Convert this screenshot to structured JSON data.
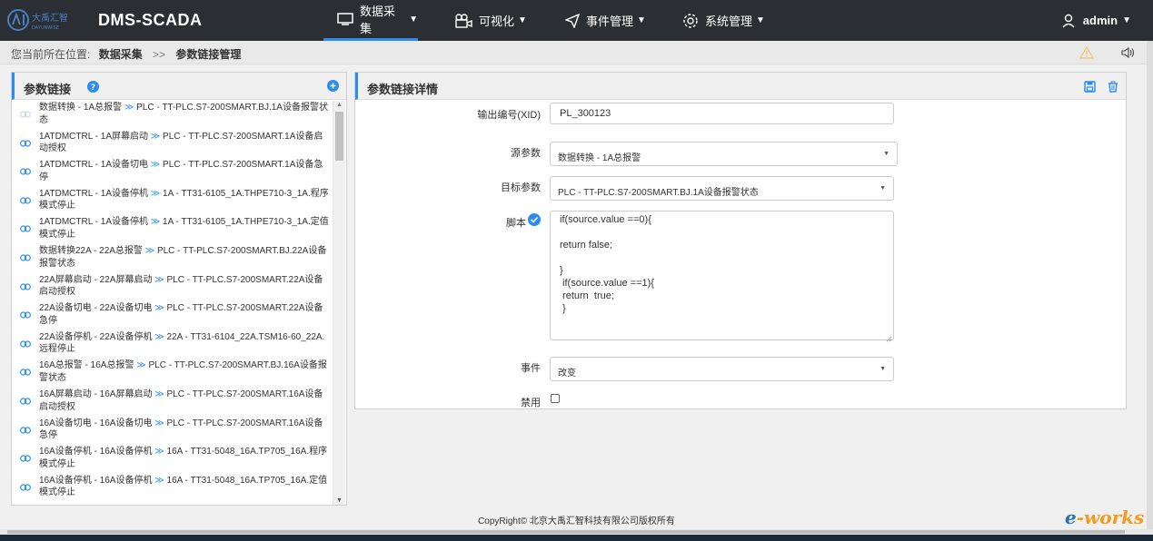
{
  "app": {
    "logo_text": "大禹汇智",
    "logo_subtext": "DAYUNWISE",
    "title": "DMS-SCADA"
  },
  "nav": [
    {
      "label": "数据采集",
      "icon": "monitor-icon",
      "active": true
    },
    {
      "label": "可视化",
      "icon": "camera-icon",
      "active": false
    },
    {
      "label": "事件管理",
      "icon": "send-icon",
      "active": false
    },
    {
      "label": "系统管理",
      "icon": "gear-icon",
      "active": false
    }
  ],
  "user": {
    "name": "admin",
    "icon": "user-icon"
  },
  "breadcrumb": {
    "prefix": "您当前所在位置:",
    "level1": "数据采集",
    "separator": ">>",
    "level2": "参数链接管理"
  },
  "left_panel": {
    "title": "参数链接",
    "items": [
      {
        "source": "数据转换 - 1A总报警",
        "target": "PLC - TT-PLC.S7-200SMART.BJ.1A设备报警状态"
      },
      {
        "source": "1ATDMCTRL - 1A屏幕启动",
        "target": "PLC - TT-PLC.S7-200SMART.1A设备启动授权"
      },
      {
        "source": "1ATDMCTRL - 1A设备切电",
        "target": "PLC - TT-PLC.S7-200SMART.1A设备急停"
      },
      {
        "source": "1ATDMCTRL - 1A设备停机",
        "target": "1A - TT31-6105_1A.THPE710-3_1A.程序模式停止"
      },
      {
        "source": "1ATDMCTRL - 1A设备停机",
        "target": "1A - TT31-6105_1A.THPE710-3_1A.定值模式停止"
      },
      {
        "source": "数据转换22A - 22A总报警",
        "target": "PLC - TT-PLC.S7-200SMART.BJ.22A设备报警状态"
      },
      {
        "source": "22A屏幕启动 - 22A屏幕启动",
        "target": "PLC - TT-PLC.S7-200SMART.22A设备启动授权"
      },
      {
        "source": "22A设备切电 - 22A设备切电",
        "target": "PLC - TT-PLC.S7-200SMART.22A设备急停"
      },
      {
        "source": "22A设备停机 - 22A设备停机",
        "target": "22A - TT31-6104_22A.TSM16-60_22A.远程停止"
      },
      {
        "source": "16A总报警 - 16A总报警",
        "target": "PLC - TT-PLC.S7-200SMART.BJ.16A设备报警状态"
      },
      {
        "source": "16A屏幕启动 - 16A屏幕启动",
        "target": "PLC - TT-PLC.S7-200SMART.16A设备启动授权"
      },
      {
        "source": "16A设备切电 - 16A设备切电",
        "target": "PLC - TT-PLC.S7-200SMART.16A设备急停"
      },
      {
        "source": "16A设备停机 - 16A设备停机",
        "target": "16A - TT31-5048_16A.TP705_16A.程序模式停止"
      },
      {
        "source": "16A设备停机 - 16A设备停机",
        "target": "16A - TT31-5048_16A.TP705_16A.定值模式停止"
      }
    ]
  },
  "right_panel": {
    "title": "参数链接详情",
    "xid_label": "输出编号(XID)",
    "xid_value": "PL_300123",
    "source_label": "源参数",
    "source_value": "数据转换 - 1A总报警",
    "target_label": "目标参数",
    "target_value": "PLC - TT-PLC.S7-200SMART.BJ.1A设备报警状态",
    "script_label": "脚本",
    "script_value": "if(source.value ==0){\n\nreturn false;\n\n}\n if(source.value ==1){\n return  true;\n }",
    "event_label": "事件",
    "event_value": "改变",
    "disabled_label": "禁用",
    "disabled_checked": false
  },
  "footer": {
    "copyright": "CopyRight© 北京大禹汇智科技有限公司版权所有"
  },
  "watermark": {
    "text_e": "e",
    "text_rest": "-works"
  },
  "colors": {
    "accent": "#2d8cf0",
    "topbar": "#2b2e33"
  }
}
